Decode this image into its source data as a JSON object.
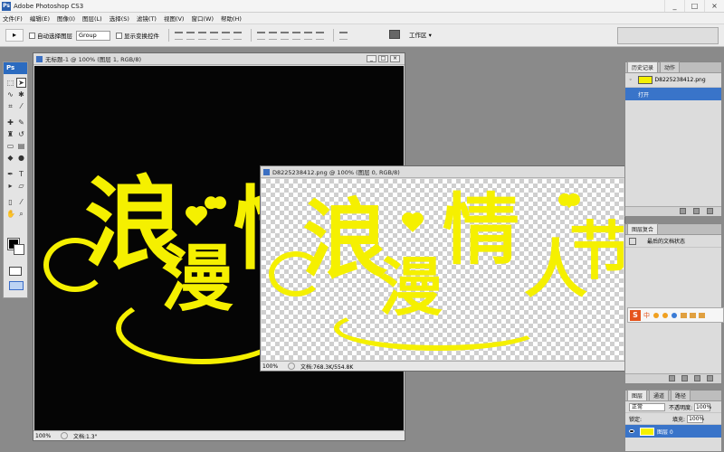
{
  "app": {
    "title": "Adobe Photoshop CS3"
  },
  "window_buttons": {
    "min": "_",
    "max": "□",
    "close": "×"
  },
  "menu": [
    "文件(F)",
    "编辑(E)",
    "图像(I)",
    "图层(L)",
    "选择(S)",
    "滤镜(T)",
    "视图(V)",
    "窗口(W)",
    "帮助(H)"
  ],
  "options": {
    "tool_preset_glyph": "▸",
    "auto_select_label": "自动选择图层",
    "auto_select_value": "Group",
    "show_transform_label": "显示变换控件",
    "workspace_label": "工作区 ▾"
  },
  "doc1": {
    "title": "无标题-1 @ 100% (图层 1, RGB/8)",
    "zoom": "100%",
    "status": "文档:1.3\"",
    "text": {
      "c1": "浪",
      "c2": "漫",
      "c3": "情"
    }
  },
  "doc2": {
    "title": "D8225238412.png @ 100% (图层 0, RGB/8)",
    "zoom": "100%",
    "status": "文档:768.3K/554.8K",
    "text": {
      "c1": "浪",
      "c2": "漫",
      "c3": "情",
      "c4": "人",
      "c5": "节"
    }
  },
  "history": {
    "tabs": [
      "历史记录",
      "动作"
    ],
    "snapshot": "D8225238412.png",
    "states": [
      "打开"
    ]
  },
  "actions_panel": {
    "tabs": [
      "图层复合"
    ],
    "row": "最后的文档状态"
  },
  "ime": {
    "logo": "S",
    "mode": "中"
  },
  "layers": {
    "tabs": [
      "图层",
      "通道",
      "路径"
    ],
    "blend_mode": "正常",
    "opacity_label": "不透明度:",
    "opacity": "100%",
    "lock_label": "锁定:",
    "fill_label": "填充:",
    "fill": "100%",
    "layer_name": "图层 0"
  },
  "colors": {
    "text_yellow": "#f5f000",
    "doc_bg": "#050505",
    "selection": "#3974c9"
  }
}
